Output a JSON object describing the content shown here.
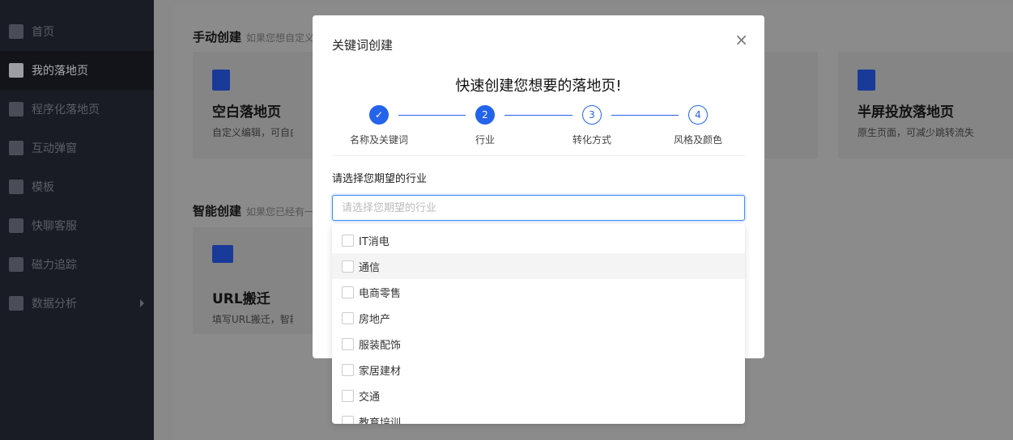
{
  "sidebar": {
    "items": [
      {
        "label": "首页",
        "icon": "home-icon"
      },
      {
        "label": "我的落地页",
        "icon": "document-icon",
        "active": true
      },
      {
        "label": "程序化落地页",
        "icon": "flow-icon"
      },
      {
        "label": "互动弹窗",
        "icon": "bookmark-icon"
      },
      {
        "label": "模板",
        "icon": "template-icon"
      },
      {
        "label": "快聊客服",
        "icon": "chat-icon"
      },
      {
        "label": "磁力追踪",
        "icon": "bookmark-icon"
      },
      {
        "label": "数据分析",
        "icon": "bar-chart-icon",
        "has_submenu": true
      }
    ]
  },
  "main": {
    "manual": {
      "title": "手动创建",
      "hint": "如果您想自定义",
      "cards": [
        {
          "title": "空白落地页",
          "desc": "自定义编辑，可自由发挥"
        },
        {
          "title": "半屏投放落地页",
          "desc": "原生页面，可减少跳转流失"
        }
      ]
    },
    "smart": {
      "title": "智能创建",
      "hint": "如果您已经有一",
      "cards": [
        {
          "title": "URL搬迁",
          "desc": "填写URL搬迁，智能迁移"
        }
      ]
    }
  },
  "modal": {
    "title": "关键词创建",
    "heading": "快速创建您想要的落地页!",
    "steps": [
      {
        "number": "✓",
        "label": "名称及关键词",
        "state": "done"
      },
      {
        "number": "2",
        "label": "行业",
        "state": "current"
      },
      {
        "number": "3",
        "label": "转化方式",
        "state": "pending"
      },
      {
        "number": "4",
        "label": "风格及颜色",
        "state": "pending"
      }
    ],
    "field_label": "请选择您期望的行业",
    "field_placeholder": "请选择您期望的行业",
    "field_value": "",
    "close": "×"
  },
  "dropdown": {
    "options": [
      "IT消电",
      "通信",
      "电商零售",
      "房地产",
      "服装配饰",
      "家居建材",
      "交通",
      "教育培训"
    ],
    "hovered": "通信"
  },
  "colors": {
    "accent": "#2463eb",
    "sidebar": "#1a1c25"
  }
}
